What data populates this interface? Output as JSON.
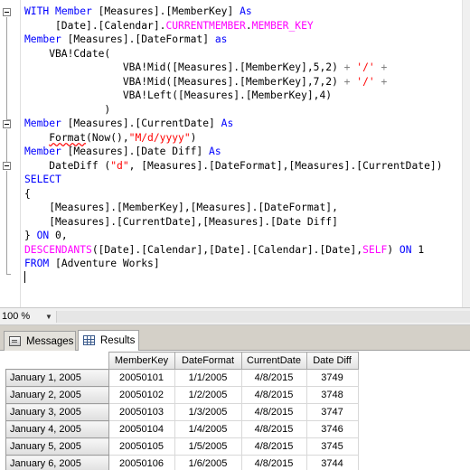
{
  "editor": {
    "lines": [
      [
        {
          "t": "WITH ",
          "c": "kw"
        },
        {
          "t": "Member ",
          "c": "kw"
        },
        {
          "t": "[Measures].[MemberKey] "
        },
        {
          "t": "As",
          "c": "kw"
        }
      ],
      [
        {
          "t": "     [Date].[Calendar]."
        },
        {
          "t": "CURRENTMEMBER",
          "c": "mg"
        },
        {
          "t": "."
        },
        {
          "t": "MEMBER_KEY",
          "c": "mg"
        }
      ],
      [
        {
          "t": "Member ",
          "c": "kw"
        },
        {
          "t": "[Measures].[DateFormat] "
        },
        {
          "t": "as",
          "c": "kw"
        }
      ],
      [
        {
          "t": "    VBA!Cdate("
        }
      ],
      [
        {
          "t": "                VBA!Mid([Measures].[MemberKey],5,2) "
        },
        {
          "t": "+ ",
          "c": "gy"
        },
        {
          "t": "'/'",
          "c": "st"
        },
        {
          "t": " +",
          "c": "gy"
        }
      ],
      [
        {
          "t": "                VBA!Mid([Measures].[MemberKey],7,2) "
        },
        {
          "t": "+ ",
          "c": "gy"
        },
        {
          "t": "'/'",
          "c": "st"
        },
        {
          "t": " +",
          "c": "gy"
        }
      ],
      [
        {
          "t": "                VBA!Left([Measures].[MemberKey],4)"
        }
      ],
      [
        {
          "t": "             )"
        }
      ],
      [
        {
          "t": "Member ",
          "c": "kw"
        },
        {
          "t": "[Measures].[CurrentDate] "
        },
        {
          "t": "As",
          "c": "kw"
        }
      ],
      [
        {
          "t": "    "
        },
        {
          "t": "Format",
          "c": "fn"
        },
        {
          "t": "(Now(),"
        },
        {
          "t": "\"M/d/yyyy\"",
          "c": "st"
        },
        {
          "t": ")"
        }
      ],
      [
        {
          "t": "Member ",
          "c": "kw"
        },
        {
          "t": "[Measures].[Date Diff] "
        },
        {
          "t": "As",
          "c": "kw"
        }
      ],
      [
        {
          "t": "    DateDiff ("
        },
        {
          "t": "\"d\"",
          "c": "st"
        },
        {
          "t": ", [Measures].[DateFormat],[Measures].[CurrentDate])"
        }
      ],
      [
        {
          "t": "SELECT",
          "c": "kw"
        }
      ],
      [
        {
          "t": "{"
        }
      ],
      [
        {
          "t": "    [Measures].[MemberKey],[Measures].[DateFormat],"
        }
      ],
      [
        {
          "t": "    [Measures].[CurrentDate],[Measures].[Date Diff]"
        }
      ],
      [
        {
          "t": "} "
        },
        {
          "t": "ON ",
          "c": "kw"
        },
        {
          "t": "0,"
        }
      ],
      [
        {
          "t": "DESCENDANTS",
          "c": "mg"
        },
        {
          "t": "([Date].[Calendar],[Date].[Calendar].[Date],"
        },
        {
          "t": "SELF",
          "c": "mg"
        },
        {
          "t": ") "
        },
        {
          "t": "ON ",
          "c": "kw"
        },
        {
          "t": "1"
        }
      ],
      [
        {
          "t": "FROM ",
          "c": "kw"
        },
        {
          "t": "[Adventure Works]"
        }
      ],
      [
        {
          "t": ""
        }
      ]
    ]
  },
  "statusbar": {
    "zoom": "100 %"
  },
  "tabs": {
    "messages": "Messages",
    "results": "Results"
  },
  "grid": {
    "columns": [
      "MemberKey",
      "DateFormat",
      "CurrentDate",
      "Date Diff"
    ],
    "rows": [
      {
        "label": "January 1, 2005",
        "cells": [
          "20050101",
          "1/1/2005",
          "4/8/2015",
          "3749"
        ]
      },
      {
        "label": "January 2, 2005",
        "cells": [
          "20050102",
          "1/2/2005",
          "4/8/2015",
          "3748"
        ]
      },
      {
        "label": "January 3, 2005",
        "cells": [
          "20050103",
          "1/3/2005",
          "4/8/2015",
          "3747"
        ]
      },
      {
        "label": "January 4, 2005",
        "cells": [
          "20050104",
          "1/4/2005",
          "4/8/2015",
          "3746"
        ]
      },
      {
        "label": "January 5, 2005",
        "cells": [
          "20050105",
          "1/5/2005",
          "4/8/2015",
          "3745"
        ]
      },
      {
        "label": "January 6, 2005",
        "cells": [
          "20050106",
          "1/6/2005",
          "4/8/2015",
          "3744"
        ]
      }
    ]
  },
  "colors": {
    "keyword": "#0000ff",
    "function": "#ff00ff",
    "string": "#ff0000",
    "operator": "#808080"
  }
}
